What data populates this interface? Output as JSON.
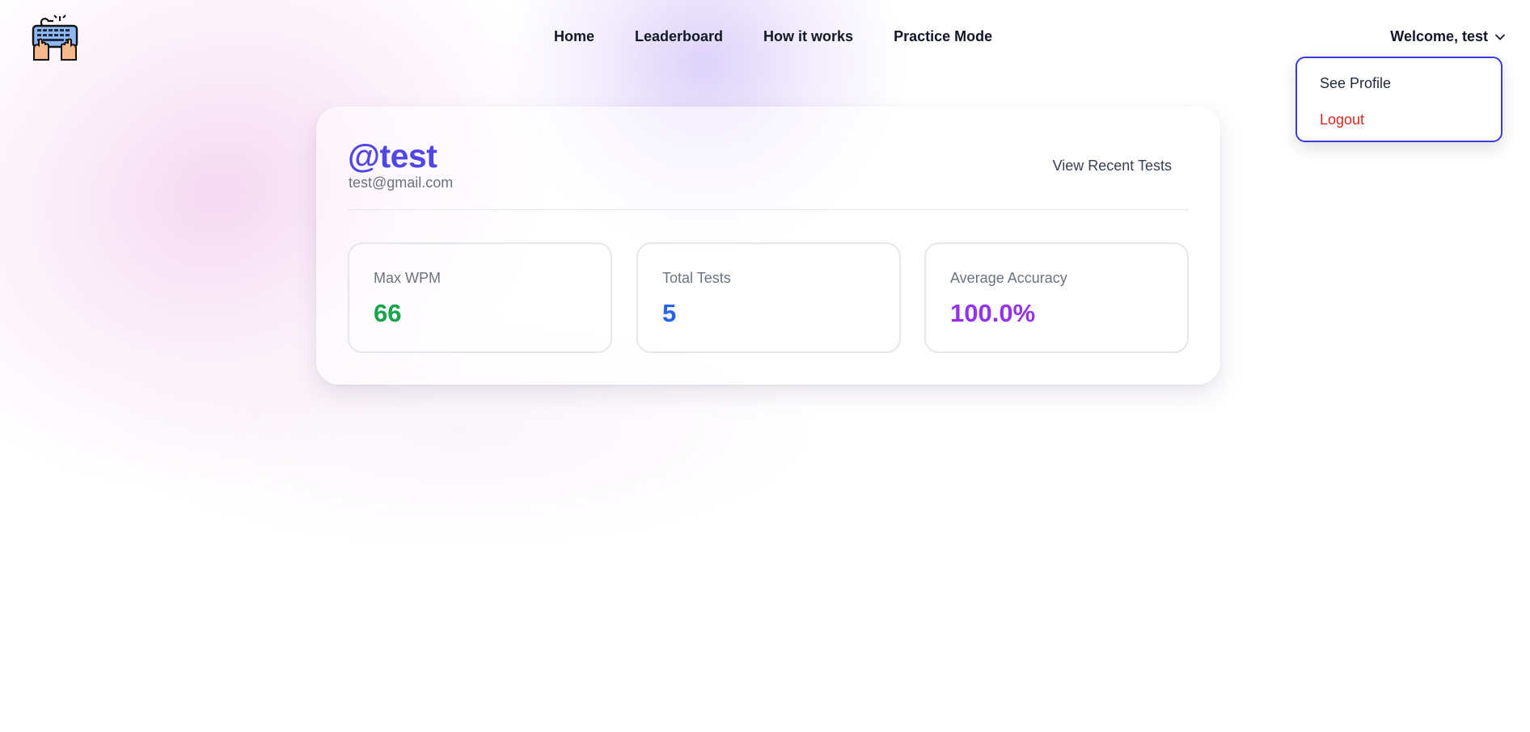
{
  "nav": {
    "items": [
      {
        "label": "Home"
      },
      {
        "label": "Leaderboard"
      },
      {
        "label": "How it works"
      },
      {
        "label": "Practice Mode"
      }
    ]
  },
  "user_menu": {
    "label": "Welcome, test",
    "icon": "chevron-down-icon"
  },
  "dropdown": {
    "items": [
      {
        "label": "See Profile",
        "color": "#1f2937"
      },
      {
        "label": "Logout",
        "color": "#dc2626"
      }
    ],
    "border_color": "#3b3bd9"
  },
  "profile": {
    "username": "@test",
    "email": "test@gmail.com",
    "recent_tests_label": "View Recent Tests"
  },
  "stats": [
    {
      "label": "Max WPM",
      "value": "66",
      "color": "#16a34a"
    },
    {
      "label": "Total Tests",
      "value": "5",
      "color": "#2563eb"
    },
    {
      "label": "Average Accuracy",
      "value": "100.0%",
      "color": "#9333ea"
    }
  ],
  "colors": {
    "accent": "#4f46e5"
  },
  "logo": {
    "icon": "keyboard-hands-icon"
  }
}
